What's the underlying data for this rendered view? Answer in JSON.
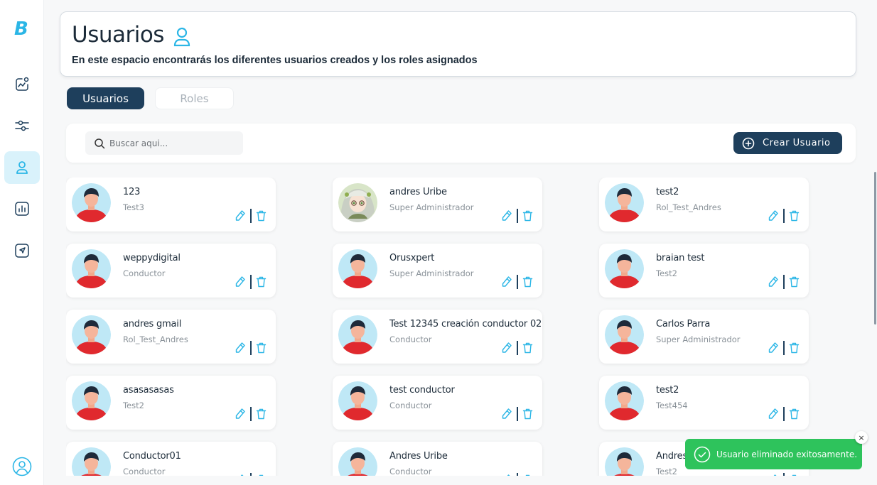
{
  "app": {
    "logo": "B"
  },
  "sidebar": {
    "items": [
      {
        "icon": "analytics-pin-icon",
        "active": false
      },
      {
        "icon": "sliders-icon",
        "active": false
      },
      {
        "icon": "user-icon",
        "active": true
      },
      {
        "icon": "bar-chart-icon",
        "active": false
      },
      {
        "icon": "navigation-icon",
        "active": false
      }
    ],
    "profile_icon": "user-circle-icon"
  },
  "header": {
    "title": "Usuarios",
    "subtitle": "En este espacio encontrarás los diferentes usuarios creados y los roles asignados"
  },
  "tabs": [
    {
      "label": "Usuarios",
      "active": true
    },
    {
      "label": "Roles",
      "active": false
    }
  ],
  "toolbar": {
    "search_placeholder": "Buscar aqui...",
    "create_label": "Crear Usuario"
  },
  "users": [
    {
      "name": "123",
      "role": "Test3",
      "avatar": "default"
    },
    {
      "name": "andres Uribe",
      "role": "Super Administrador",
      "avatar": "anime"
    },
    {
      "name": "test2",
      "role": "Rol_Test_Andres",
      "avatar": "default"
    },
    {
      "name": "weppydigital",
      "role": "Conductor",
      "avatar": "default"
    },
    {
      "name": "Orusxpert",
      "role": "Super Administrador",
      "avatar": "default"
    },
    {
      "name": "braian test",
      "role": "Test2",
      "avatar": "default"
    },
    {
      "name": "andres gmail",
      "role": "Rol_Test_Andres",
      "avatar": "default"
    },
    {
      "name": "Test 12345 creación conductor 02",
      "role": "Conductor",
      "avatar": "default"
    },
    {
      "name": "Carlos Parra",
      "role": "Super Administrador",
      "avatar": "default"
    },
    {
      "name": "asasasasas",
      "role": "Test2",
      "avatar": "default"
    },
    {
      "name": "test conductor",
      "role": "Conductor",
      "avatar": "default"
    },
    {
      "name": "test2",
      "role": "Test454",
      "avatar": "default"
    },
    {
      "name": "Conductor01",
      "role": "Conductor",
      "avatar": "default"
    },
    {
      "name": "Andres Uribe",
      "role": "Conductor",
      "avatar": "default"
    },
    {
      "name": "Andres",
      "role": "Test2",
      "avatar": "default"
    }
  ],
  "toast": {
    "message": "Usuario eliminado exitosamente.",
    "close": "×"
  },
  "colors": {
    "primary": "#1e3f5c",
    "accent": "#2bb6e6",
    "success": "#2ec35c",
    "avatar_bg": "#bfe8f6",
    "avatar_shirt": "#e0292e"
  }
}
